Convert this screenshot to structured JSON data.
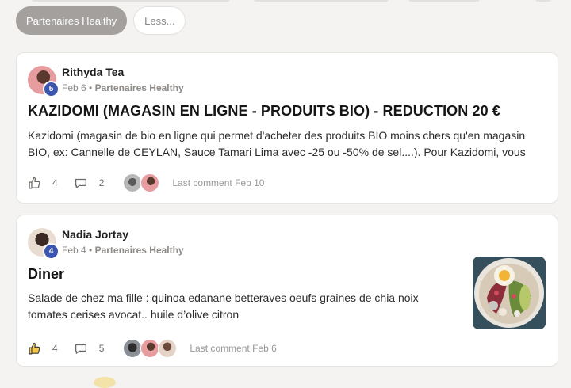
{
  "filters": {
    "active_label": "Partenaires Healthy",
    "less_label": "Less..."
  },
  "posts": [
    {
      "author": "Rithyda Tea",
      "level": "5",
      "date": "Feb 6",
      "separator": "•",
      "category": "Partenaires Healthy",
      "title": "KAZIDOMI (MAGASIN EN LIGNE - PRODUITS BIO) - REDUCTION 20 €",
      "excerpt": "Kazidomi (magasin de bio en ligne qui permet d'acheter des produits BIO moins chers qu'en magasin BIO, ex: Cannelle de CEYLAN, Sauce Tamari Lima avec -25 ou -50% de sel....). Pour Kazidomi, vous",
      "likes": "4",
      "comments": "2",
      "last_comment": "Last comment Feb 10",
      "liked": false
    },
    {
      "author": "Nadia Jortay",
      "level": "4",
      "date": "Feb 4",
      "separator": "•",
      "category": "Partenaires Healthy",
      "title": "Diner",
      "excerpt": "Salade de chez ma fille : quinoa edanane betteraves oeufs graines de chia noix tomates cerises avocat.. huile d’olive citron",
      "likes": "4",
      "comments": "5",
      "last_comment": "Last comment Feb 6",
      "liked": true
    }
  ],
  "icons": {
    "like": "thumbs-up-icon",
    "liked": "thumbs-up-filled-icon",
    "comment": "speech-bubble-icon"
  },
  "colors": {
    "active_chip": "#a3a09d",
    "level_badge": "#3a56b0",
    "liked_fill": "#f2c94c",
    "page_background": "#f4f3f2"
  }
}
